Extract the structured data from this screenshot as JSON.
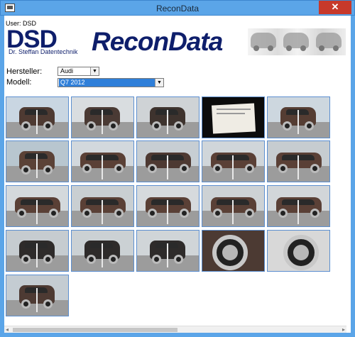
{
  "window": {
    "title": "ReconData",
    "close_glyph": "✕",
    "app_icon": "app-window-icon"
  },
  "user": {
    "label": "User: DSD"
  },
  "banner": {
    "brand": "DSD",
    "subtitle": "Dr. Steffan Datentechnik",
    "product": "ReconData"
  },
  "form": {
    "manufacturer_label": "Hersteller:",
    "manufacturer_value": "Audi",
    "model_label": "Modell:",
    "model_value": "Q7 2012"
  },
  "colors": {
    "titlebar": "#5ba5e8",
    "brand_navy": "#0e1e6b",
    "selection_blue": "#2f7fd9",
    "thumb_border": "#5c8fd0",
    "close_red": "#c7392b"
  },
  "thumbnails": [
    {
      "kind": "rear-quarter",
      "sky": "#c9d6e2",
      "car": "#4e3a32"
    },
    {
      "kind": "rear-quarter",
      "sky": "#d9dde0",
      "car": "#4a3a34"
    },
    {
      "kind": "front-quarter",
      "sky": "#cfd3d6",
      "car": "#3e332e"
    },
    {
      "kind": "document",
      "sky": "#101010",
      "car": "#101010"
    },
    {
      "kind": "rear",
      "sky": "#cdd7df",
      "car": "#553d33"
    },
    {
      "kind": "rear",
      "sky": "#b8c6cf",
      "car": "#5b4237"
    },
    {
      "kind": "side",
      "sky": "#d2d8dd",
      "car": "#5a4036"
    },
    {
      "kind": "side",
      "sky": "#c7ced3",
      "car": "#4d3932"
    },
    {
      "kind": "side",
      "sky": "#d0d6da",
      "car": "#5a4036"
    },
    {
      "kind": "side",
      "sky": "#c6ccd0",
      "car": "#5a4036"
    },
    {
      "kind": "side",
      "sky": "#d4d9dc",
      "car": "#5a4036"
    },
    {
      "kind": "side",
      "sky": "#c9cfd2",
      "car": "#5a4036"
    },
    {
      "kind": "side",
      "sky": "#d6dadd",
      "car": "#5a4036"
    },
    {
      "kind": "side",
      "sky": "#cdd2d5",
      "car": "#5a4036"
    },
    {
      "kind": "side",
      "sky": "#d2d6d9",
      "car": "#5a4036"
    },
    {
      "kind": "front",
      "sky": "#c6ccd0",
      "car": "#2e2b2a"
    },
    {
      "kind": "front",
      "sky": "#cbd1d4",
      "car": "#2e2b2a"
    },
    {
      "kind": "front",
      "sky": "#d0d5d8",
      "car": "#2e2b2a"
    },
    {
      "kind": "wheel",
      "sky": "#4c3a33",
      "car": "#4c3a33"
    },
    {
      "kind": "wheel",
      "sky": "#d8d8d8",
      "car": "#8a8a8a"
    },
    {
      "kind": "front-quarter",
      "sky": "#c4ccd2",
      "car": "#4d3a33"
    }
  ],
  "scrollbar": {
    "left_arrow": "◂",
    "right_arrow": "▸"
  }
}
